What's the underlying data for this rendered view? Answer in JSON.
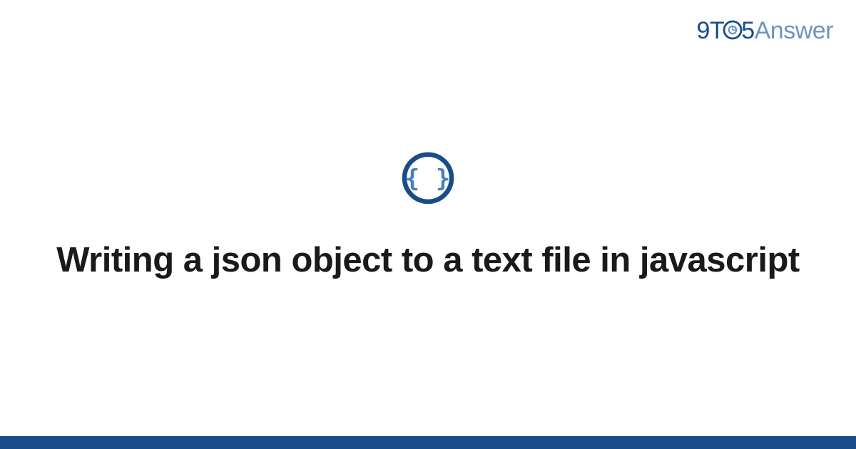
{
  "header": {
    "logo": {
      "prefix": "9T",
      "middle_glyph": "clock-o-icon",
      "digit": "5",
      "suffix": "Answer"
    }
  },
  "main": {
    "icon": "braces-icon",
    "title": "Writing a json object to a text file in javascript"
  },
  "colors": {
    "brand_dark": "#184d8a",
    "brand_light": "#6d93c2",
    "text": "#1a1a1a",
    "background": "#ffffff"
  }
}
